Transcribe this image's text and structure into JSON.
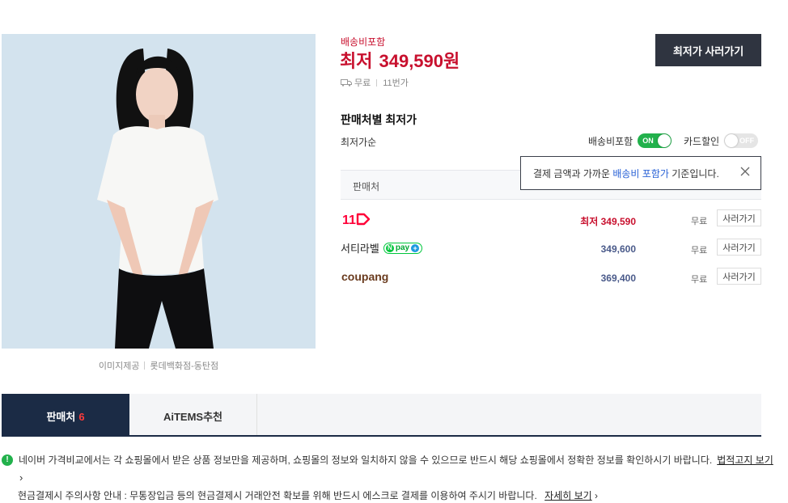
{
  "image": {
    "alt": "product photo",
    "caption_left": "이미지제공",
    "caption_right": "롯데백화점-동탄점"
  },
  "price_block": {
    "shipping_included": "배송비포함",
    "price_label": "최저",
    "price": "349,590원",
    "shipping": "무료",
    "store": "11번가",
    "cta": "최저가 사러가기"
  },
  "sellers": {
    "title": "판매처별 최저가",
    "sort": "최저가순",
    "toggle_shipping_label": "배송비포함",
    "toggle_shipping_state": "ON",
    "toggle_card_label": "카드할인",
    "toggle_card_state": "OFF",
    "tooltip": {
      "prefix": "결제 금액과 가까운 ",
      "highlight": "배송비 포함가",
      "suffix": " 기준입니다."
    },
    "column_header": "판매처",
    "rows": [
      {
        "store": "11번가",
        "price": "최저 349,590",
        "shipping": "무료",
        "buy": "사러가기"
      },
      {
        "store": "서티라벨",
        "price": "349,600",
        "shipping": "무료",
        "buy": "사러가기",
        "badge": "pay"
      },
      {
        "store": "coupang",
        "price": "369,400",
        "shipping": "무료",
        "buy": "사러가기"
      }
    ]
  },
  "tabs": [
    {
      "label": "판매처",
      "count": "6"
    },
    {
      "label": "AiTEMS추천"
    }
  ],
  "notices": {
    "main": "네이버 가격비교에서는 각 쇼핑몰에서 받은 상품 정보만을 제공하며, 쇼핑몰의 정보와 일치하지 않을 수 있으므로 반드시 해당 쇼핑몰에서 정확한 정보를 확인하시기 바랍니다.",
    "main_link": "법적고지 보기",
    "cash": "현금결제시 주의사항 안내 : 무통장입금 등의 현금결제시 거래안전 확보를 위해 반드시 에스크로 결제를 이용하여 주시기 바랍니다.",
    "cash_link": "자세히 보기"
  },
  "colors": {
    "price_red": "#c8102e",
    "cta_dark": "#2f3440",
    "toggle_green": "#22b14c",
    "tab_navy": "#1b2b45"
  }
}
